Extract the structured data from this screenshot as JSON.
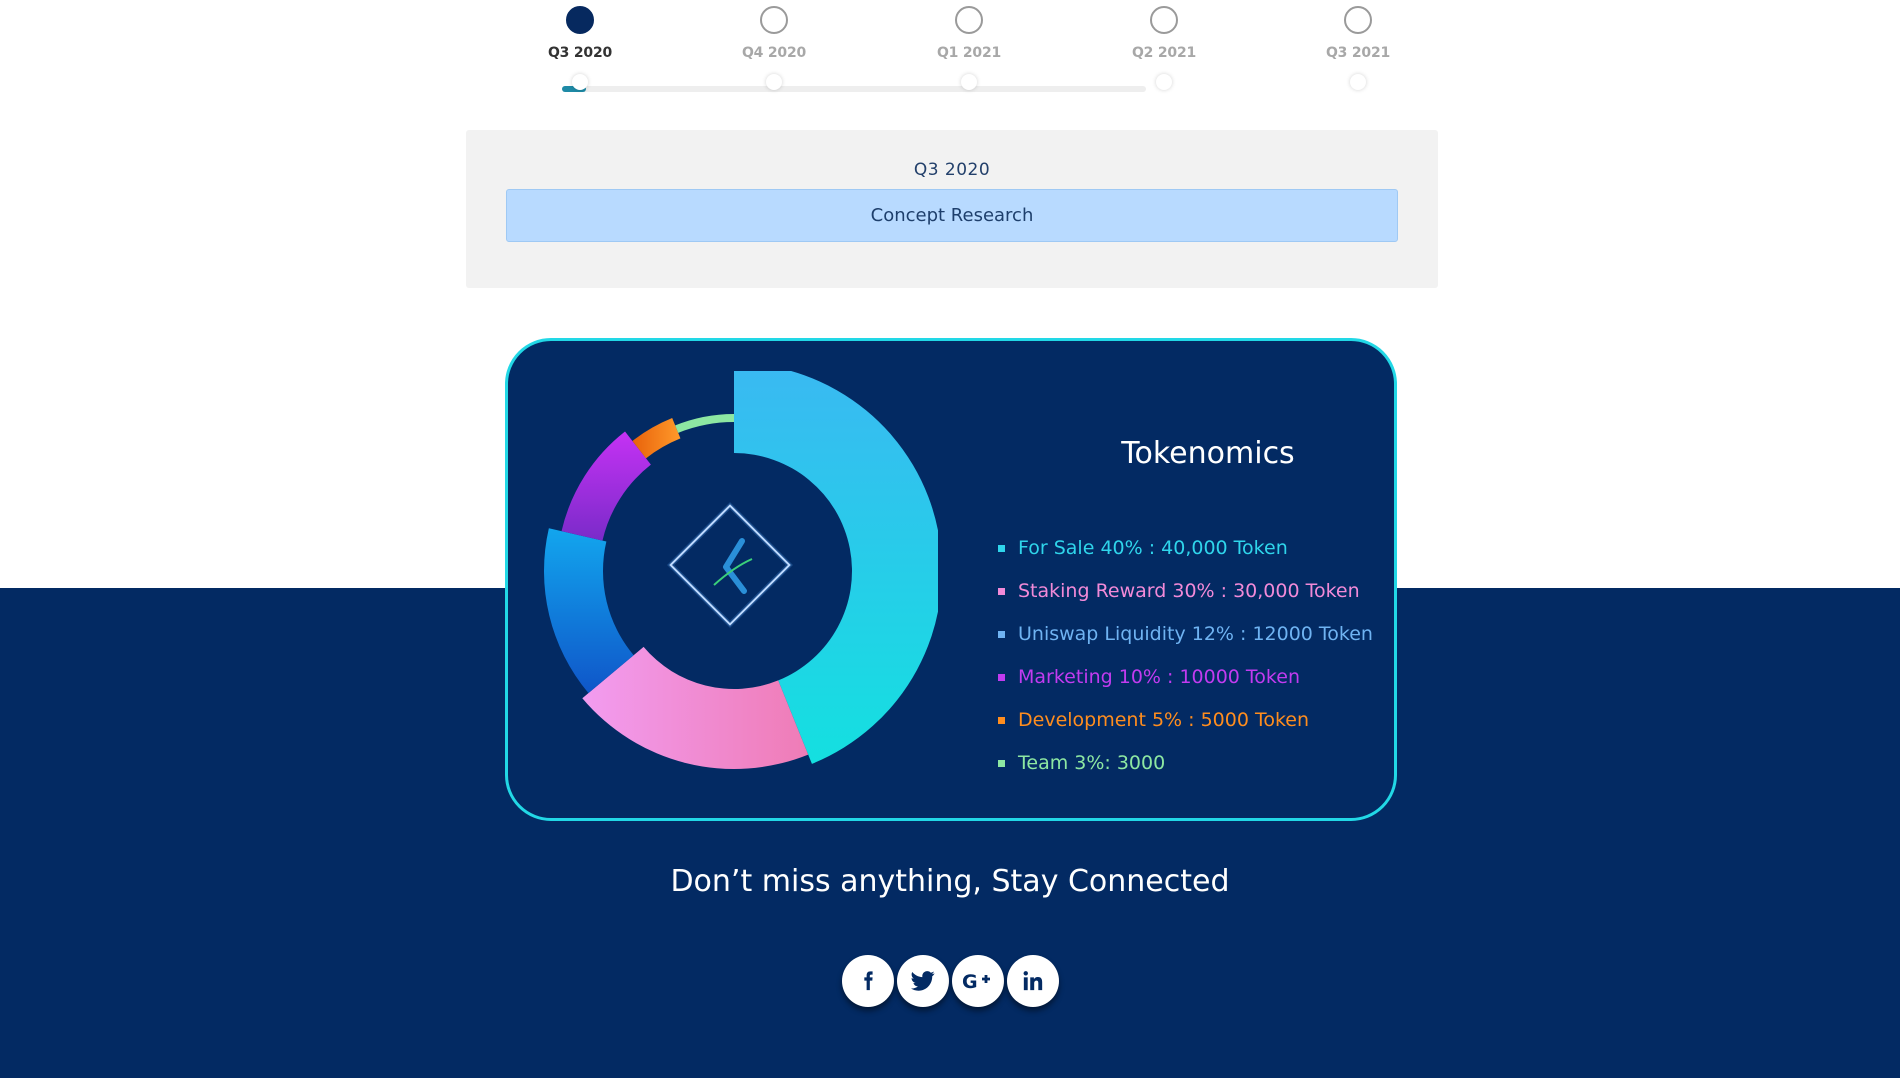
{
  "timeline": {
    "steps": [
      {
        "label": "Q3 2020",
        "active": true
      },
      {
        "label": "Q4 2020",
        "active": false
      },
      {
        "label": "Q1 2021",
        "active": false
      },
      {
        "label": "Q2 2021",
        "active": false
      },
      {
        "label": "Q3 2021",
        "active": false
      }
    ],
    "progress_percent": 3
  },
  "stage": {
    "title": "Q3 2020",
    "items": [
      "Concept Research"
    ]
  },
  "tokenomics": {
    "title": "Tokenomics",
    "logo_icon": "k-diamond-logo-icon",
    "legend": [
      {
        "text": "For Sale 40% : 40,000 Token",
        "color": "#2fd5eb"
      },
      {
        "text": "Staking Reward 30% : 30,000 Token",
        "color": "#f28ad8"
      },
      {
        "text": "Uniswap Liquidity 12% : 12000 Token",
        "color": "#6fb3f2"
      },
      {
        "text": "Marketing 10% : 10000 Token",
        "color": "#c23bf0"
      },
      {
        "text": "Development 5% : 5000 Token",
        "color": "#ff8d1e"
      },
      {
        "text": "Team 3%: 3000",
        "color": "#8de7a2"
      }
    ]
  },
  "footer": {
    "tagline": "Don’t miss anything, Stay Connected",
    "socials": [
      {
        "icon": "facebook-icon"
      },
      {
        "icon": "twitter-icon"
      },
      {
        "icon": "google-plus-icon"
      },
      {
        "icon": "linkedin-icon"
      }
    ]
  },
  "colors": {
    "navy": "#032a63",
    "card_border": "#22d8e6",
    "active_step": "#06295f",
    "stage_item_bg": "#b8daff"
  }
}
